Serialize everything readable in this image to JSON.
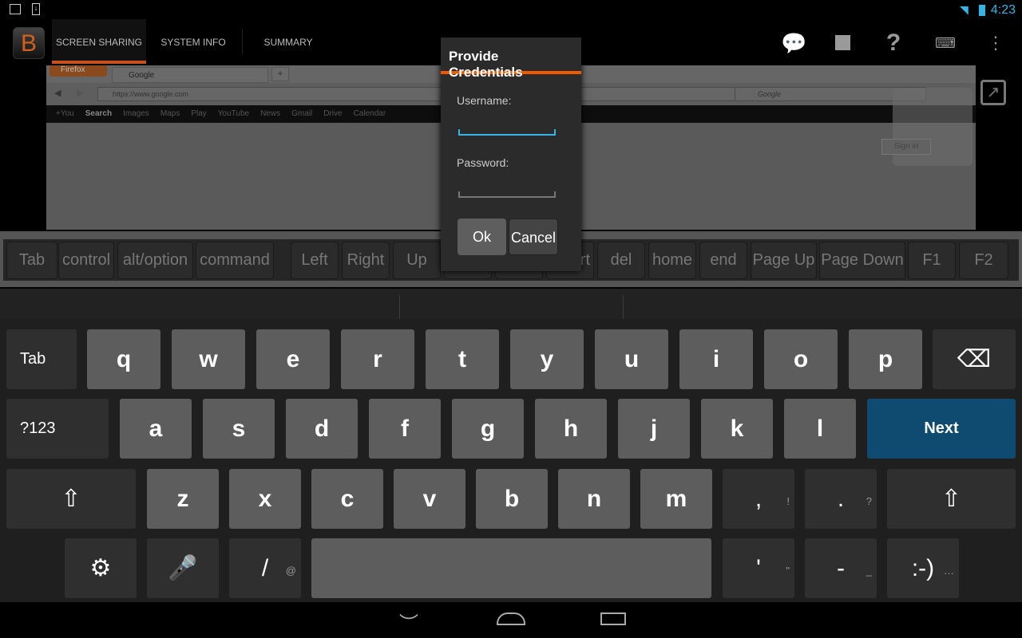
{
  "status_bar": {
    "left_icons": [
      "image-icon",
      "download-icon"
    ],
    "right_icons": [
      "wifi-icon",
      "battery-icon"
    ],
    "time": "4:23"
  },
  "app": {
    "logo": "B",
    "tabs": [
      {
        "label": "SCREEN SHARING",
        "active": true
      },
      {
        "label": "SYSTEM INFO"
      },
      {
        "label": "SUMMARY"
      }
    ],
    "actions": [
      "chat-icon",
      "stop-icon",
      "help-icon",
      "keyboard-icon",
      "overflow-icon"
    ],
    "accent": "#c8501a"
  },
  "remote": {
    "firefox_button": "Firefox",
    "tab_title": "Google",
    "url": "https://www.google.com",
    "search_placeholder": "Google",
    "google_bar": [
      "+You",
      "Search",
      "Images",
      "Maps",
      "Play",
      "YouTube",
      "News",
      "Gmail",
      "Drive",
      "Calendar"
    ],
    "sign_in": "Sign in"
  },
  "special_keys": [
    "Tab",
    "control",
    "alt/option",
    "command",
    "Left",
    "Right",
    "Up",
    "",
    "",
    "Insert",
    "del",
    "home",
    "end",
    "Page Up",
    "Page Down",
    "F1",
    "F2"
  ],
  "keyboard": {
    "row1": [
      "Tab",
      "q",
      "w",
      "e",
      "r",
      "t",
      "y",
      "u",
      "i",
      "o",
      "p",
      "⌫"
    ],
    "row2": [
      "?123",
      "a",
      "s",
      "d",
      "f",
      "g",
      "h",
      "j",
      "k",
      "l",
      "Next"
    ],
    "row3": [
      "⇧",
      "z",
      "x",
      "c",
      "v",
      "b",
      "n",
      "m",
      ",",
      ".",
      "⇧"
    ],
    "row3_hints": {
      "8": "!",
      "9": "?"
    },
    "row4": [
      "⚙",
      "🎤",
      "/",
      " ",
      "'",
      "-",
      ":-)"
    ],
    "row4_hints": {
      "2": "@",
      "4": "\"",
      "5": "_",
      "6": "…"
    },
    "action_color": "#0f4b70"
  },
  "dialog": {
    "title": "Provide Credentials",
    "username_label": "Username:",
    "username_value": "",
    "password_label": "Password:",
    "password_value": "",
    "ok": "Ok",
    "cancel": "Cancel"
  },
  "nav": [
    "back-icon",
    "home-icon",
    "recents-icon"
  ]
}
